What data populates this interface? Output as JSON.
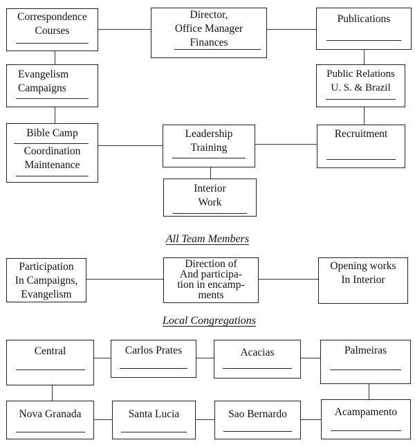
{
  "chart": {
    "top_section": {
      "boxes": {
        "correspondence": "Correspondence\nCourses",
        "director": "Director,\nOffice Manager\nFinances",
        "publications": "Publications",
        "evangelism": "Evangelism\nCampaigns",
        "public_relations": "Public Relations\nU. S. & Brazil",
        "bible_camp": "Bible Camp",
        "coordination": "Coordination\nMaintenance",
        "leadership": "Leadership\nTraining",
        "recruitment": "Recruitment",
        "interior_work": "Interior\nWork"
      }
    },
    "team_section": {
      "heading": "All Team Members",
      "boxes": {
        "participation": "Participation\nIn Campaigns,\nEvangelism",
        "direction": "Direction of\nAnd participa-\ntion in encamp-\nments",
        "opening": "Opening works\nIn Interior"
      }
    },
    "congregations_section": {
      "heading": "Local Congregations",
      "row1": [
        "Central",
        "Carlos Prates",
        "Acacias",
        "Palmeiras"
      ],
      "row2": [
        "Nova Granada",
        "Santa Lucia",
        "Sao Bernardo",
        "Acampamento"
      ]
    }
  }
}
